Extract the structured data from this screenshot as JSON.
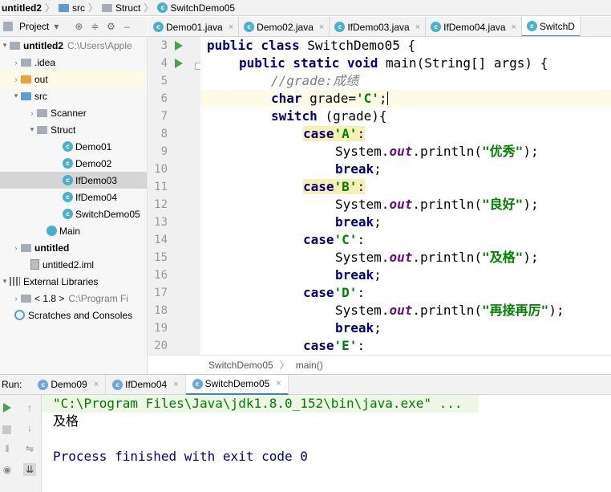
{
  "navbar": {
    "project": "untitled2",
    "src": "src",
    "struct": "Struct",
    "file": "SwitchDemo05"
  },
  "project_panel": {
    "title": "Project",
    "items": [
      {
        "label": "untitled2",
        "extra": "C:\\Users\\Apple"
      },
      {
        "label": ".idea"
      },
      {
        "label": "out"
      },
      {
        "label": "src"
      },
      {
        "label": "Scanner"
      },
      {
        "label": "Struct"
      },
      {
        "label": "Demo01"
      },
      {
        "label": "Demo02"
      },
      {
        "label": "IfDemo03"
      },
      {
        "label": "IfDemo04"
      },
      {
        "label": "SwitchDemo05"
      },
      {
        "label": "Main"
      },
      {
        "label": "untitled"
      },
      {
        "label": "untitled2.iml"
      },
      {
        "label": "External Libraries"
      },
      {
        "label": "< 1.8 >",
        "extra": "C:\\Program Fi"
      },
      {
        "label": "Scratches and Consoles"
      }
    ]
  },
  "editor_tabs": [
    {
      "label": "Demo01.java",
      "close": "×"
    },
    {
      "label": "Demo02.java",
      "close": "×"
    },
    {
      "label": "IfDemo03.java",
      "close": "×"
    },
    {
      "label": "IfDemo04.java",
      "close": "×"
    },
    {
      "label": "SwitchD",
      "close": ""
    }
  ],
  "line_numbers": [
    "3",
    "4",
    "5",
    "6",
    "7",
    "8",
    "9",
    "10",
    "11",
    "12",
    "13",
    "14",
    "15",
    "16",
    "17",
    "18",
    "19",
    "20"
  ],
  "code": {
    "class_decl_kw": "public class ",
    "class_name": "SwitchDemo05 {",
    "main_kw": "public static void ",
    "main_sig": "main(String[] args) {",
    "comment": "//grade:成绩",
    "char_kw": "char ",
    "grade_assign": "grade=",
    "char_c": "'C'",
    "semi": ";",
    "switch_kw": "switch ",
    "switch_arg": "(grade){",
    "case_kw": "case",
    "case_a": "'A'",
    "case_b": "'B'",
    "case_c": "'C'",
    "case_d": "'D'",
    "case_e": "'E'",
    "colon": ":",
    "system": "System.",
    "out": "out",
    "println_open": ".println(",
    "str_1": "\"优秀\"",
    "str_2": "\"良好\"",
    "str_3": "\"及格\"",
    "str_4": "\"再接再厉\"",
    "close_stmt": ");",
    "break_kw": "break",
    "break_semi": ";"
  },
  "editor_breadcrumb": {
    "class": "SwitchDemo05",
    "method": "main()"
  },
  "run_panel": {
    "label": "Run:",
    "tabs": [
      {
        "label": "Demo09",
        "close": "×"
      },
      {
        "label": "IfDemo04",
        "close": "×"
      },
      {
        "label": "SwitchDemo05",
        "close": "×"
      }
    ],
    "console": {
      "command": "\"C:\\Program Files\\Java\\jdk1.8.0_152\\bin\\java.exe\" ...",
      "output": "及格",
      "exit": "Process finished with exit code 0"
    }
  }
}
